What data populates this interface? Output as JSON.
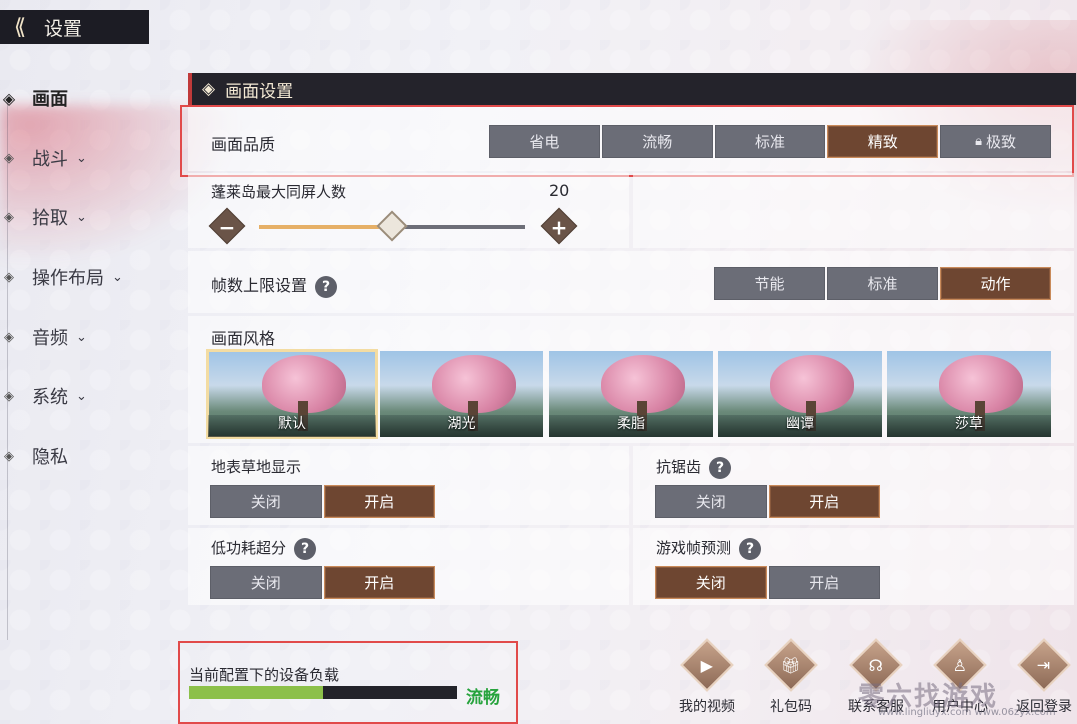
{
  "header": {
    "title": "设置"
  },
  "sidebar": {
    "items": [
      {
        "label": "画面",
        "active": true,
        "expandable": false
      },
      {
        "label": "战斗",
        "active": false,
        "expandable": true
      },
      {
        "label": "拾取",
        "active": false,
        "expandable": true
      },
      {
        "label": "操作布局",
        "active": false,
        "expandable": true
      },
      {
        "label": "音频",
        "active": false,
        "expandable": true
      },
      {
        "label": "系统",
        "active": false,
        "expandable": true
      },
      {
        "label": "隐私",
        "active": false,
        "expandable": false
      }
    ]
  },
  "panel": {
    "title": "画面设置",
    "quality": {
      "label": "画面品质",
      "options": [
        "省电",
        "流畅",
        "标准",
        "精致",
        "极致"
      ],
      "selected": "精致",
      "locked": "极致"
    },
    "max_players": {
      "label": "蓬莱岛最大同屏人数",
      "value": "20",
      "fraction": 0.5
    },
    "framerate": {
      "label": "帧数上限设置",
      "options": [
        "节能",
        "标准",
        "动作"
      ],
      "selected": "动作"
    },
    "style": {
      "label": "画面风格",
      "options": [
        "默认",
        "湖光",
        "柔脂",
        "幽谭",
        "莎草"
      ],
      "selected": "默认"
    },
    "grass": {
      "label": "地表草地显示",
      "options": [
        "关闭",
        "开启"
      ],
      "selected": "开启"
    },
    "antialias": {
      "label": "抗锯齿",
      "options": [
        "关闭",
        "开启"
      ],
      "selected": "开启"
    },
    "lowpower_sr": {
      "label": "低功耗超分",
      "options": [
        "关闭",
        "开启"
      ],
      "selected": "开启"
    },
    "frame_predict": {
      "label": "游戏帧预测",
      "options": [
        "关闭",
        "开启"
      ],
      "selected": "关闭"
    }
  },
  "load": {
    "label": "当前配置下的设备负载",
    "status": "流畅",
    "fraction": 0.5
  },
  "bottom": {
    "items": [
      {
        "label": "我的视频",
        "icon": "play-icon"
      },
      {
        "label": "礼包码",
        "icon": "gift-icon"
      },
      {
        "label": "联系客服",
        "icon": "headset-icon"
      },
      {
        "label": "用户中心",
        "icon": "user-icon"
      },
      {
        "label": "返回登录",
        "icon": "logout-icon"
      }
    ]
  },
  "watermark": {
    "text": "零六找游戏",
    "url": "www.lingliuyx.com  www.06zyx.com"
  },
  "colors": {
    "selected": "#6e4631",
    "option": "#6b6d77",
    "status_ok": "#27a33d",
    "highlight_box": "#e14a4a"
  }
}
